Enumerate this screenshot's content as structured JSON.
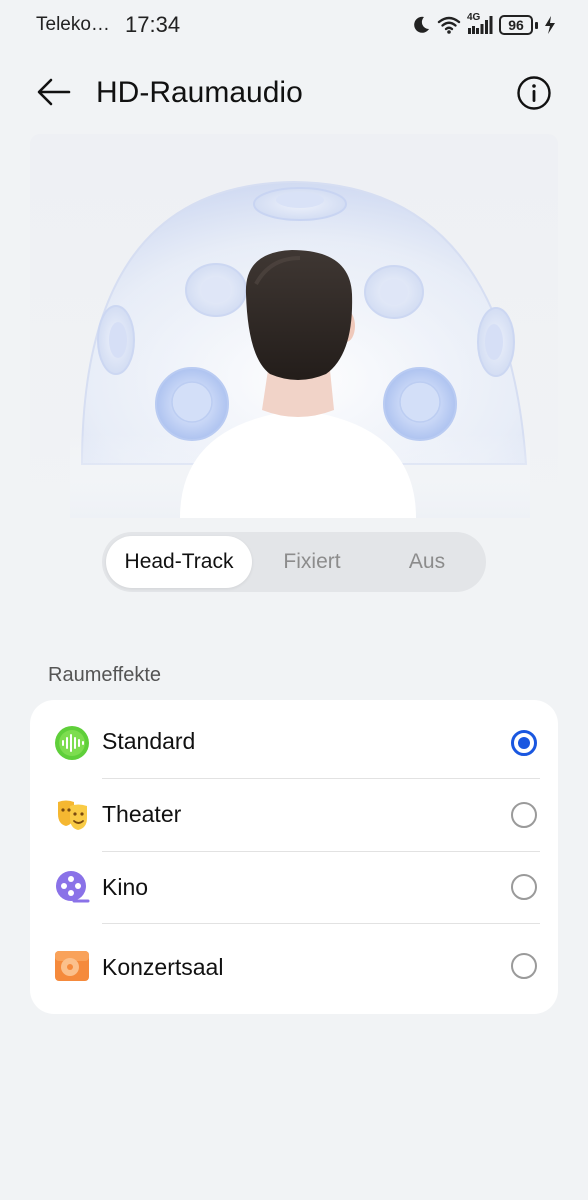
{
  "status_bar": {
    "carrier": "Teleko…",
    "time": "17:34",
    "network": "4G",
    "battery": "96",
    "icons": [
      "moon-icon",
      "wifi-icon",
      "signal-icon",
      "battery-icon",
      "charging-icon"
    ]
  },
  "header": {
    "title": "HD-Raumaudio",
    "back_icon": "arrow-left-icon",
    "info_icon": "info-circle-icon"
  },
  "mode_selector": {
    "options": [
      "Head-Track",
      "Fixiert",
      "Aus"
    ],
    "selected": "Head-Track"
  },
  "section": {
    "title": "Raumeffekte"
  },
  "effects": [
    {
      "label": "Standard",
      "icon": "soundwave-icon",
      "selected": true
    },
    {
      "label": "Theater",
      "icon": "theater-masks-icon",
      "selected": false
    },
    {
      "label": "Kino",
      "icon": "film-reel-icon",
      "selected": false
    },
    {
      "label": "Konzertsaal",
      "icon": "concert-hall-icon",
      "selected": false
    }
  ],
  "colors": {
    "accent": "#1a57e0",
    "background": "#f1f3f5",
    "card": "#ffffff",
    "standard_icon": "#5fcf3a",
    "theater_icon": "#f5b731",
    "kino_icon": "#8a72e8",
    "konzertsaal_icon": "#f58a3c"
  }
}
